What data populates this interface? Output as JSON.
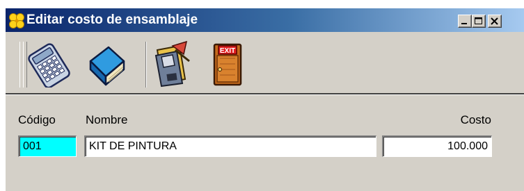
{
  "window": {
    "title": "Editar costo de ensamblaje",
    "app_icon": "clover-icon",
    "controls": {
      "minimize_icon": "minimize-icon",
      "maximize_icon": "maximize-icon",
      "close_icon": "close-icon"
    }
  },
  "toolbar": {
    "buttons": [
      {
        "id": "calculator",
        "icon": "calculator-icon"
      },
      {
        "id": "book",
        "icon": "book-icon"
      },
      {
        "id": "save",
        "icon": "save-icon"
      },
      {
        "id": "exit",
        "icon": "exit-door-icon",
        "icon_text": "EXIT"
      }
    ]
  },
  "form": {
    "codigo": {
      "label": "Código",
      "value": "001"
    },
    "nombre": {
      "label": "Nombre",
      "value": "KIT DE PINTURA"
    },
    "costo": {
      "label": "Costo",
      "value": "100.000"
    }
  },
  "colors": {
    "title_gradient_start": "#0a246a",
    "title_gradient_end": "#a6caf0",
    "window_bg": "#d4d0c8",
    "codigo_field_bg": "#00ffff"
  }
}
